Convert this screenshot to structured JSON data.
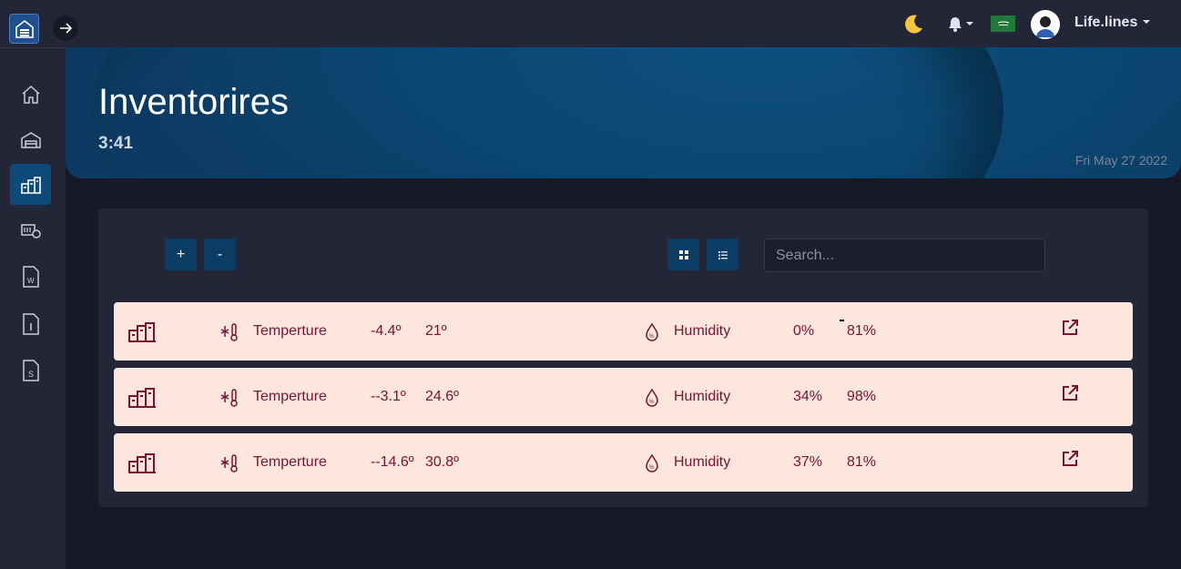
{
  "header": {
    "user_name": "Life.lines",
    "icons": [
      "toggle-arrow-icon",
      "moon-icon",
      "bell-icon",
      "flag-icon",
      "avatar"
    ]
  },
  "sidebar": {
    "items": [
      {
        "icon": "home-icon",
        "active": false
      },
      {
        "icon": "warehouse-icon",
        "active": false
      },
      {
        "icon": "inventory-icon",
        "active": true
      },
      {
        "icon": "device-settings-icon",
        "active": false
      },
      {
        "icon": "word-document-icon",
        "active": false
      },
      {
        "icon": "info-document-icon",
        "active": false
      },
      {
        "icon": "s-document-icon",
        "active": false
      }
    ]
  },
  "hero": {
    "title": "Inventorires",
    "time": "3:41",
    "date": "Fri May 27 2022"
  },
  "toolbar": {
    "add_label": "+",
    "remove_label": "-",
    "search_placeholder": "Search...",
    "view_grid_icon": "grid-view-icon",
    "view_list_icon": "list-view-icon"
  },
  "rows": [
    {
      "temp_label": "Temperture",
      "temp_min": "-4.4º",
      "temp_max": "21º",
      "hum_label": "Humidity",
      "hum_min": "0%",
      "hum_max": "81%"
    },
    {
      "temp_label": "Temperture",
      "temp_min": "--3.1º",
      "temp_max": "24.6º",
      "hum_label": "Humidity",
      "hum_min": "34%",
      "hum_max": "98%"
    },
    {
      "temp_label": "Temperture",
      "temp_min": "--14.6º",
      "temp_max": "30.8º",
      "hum_label": "Humidity",
      "hum_min": "37%",
      "hum_max": "81%"
    }
  ],
  "colors": {
    "background": "#171a26",
    "panel": "#222636",
    "accent": "#0b4a79",
    "row_bg": "#fde6dc",
    "row_text": "#7a1232"
  }
}
